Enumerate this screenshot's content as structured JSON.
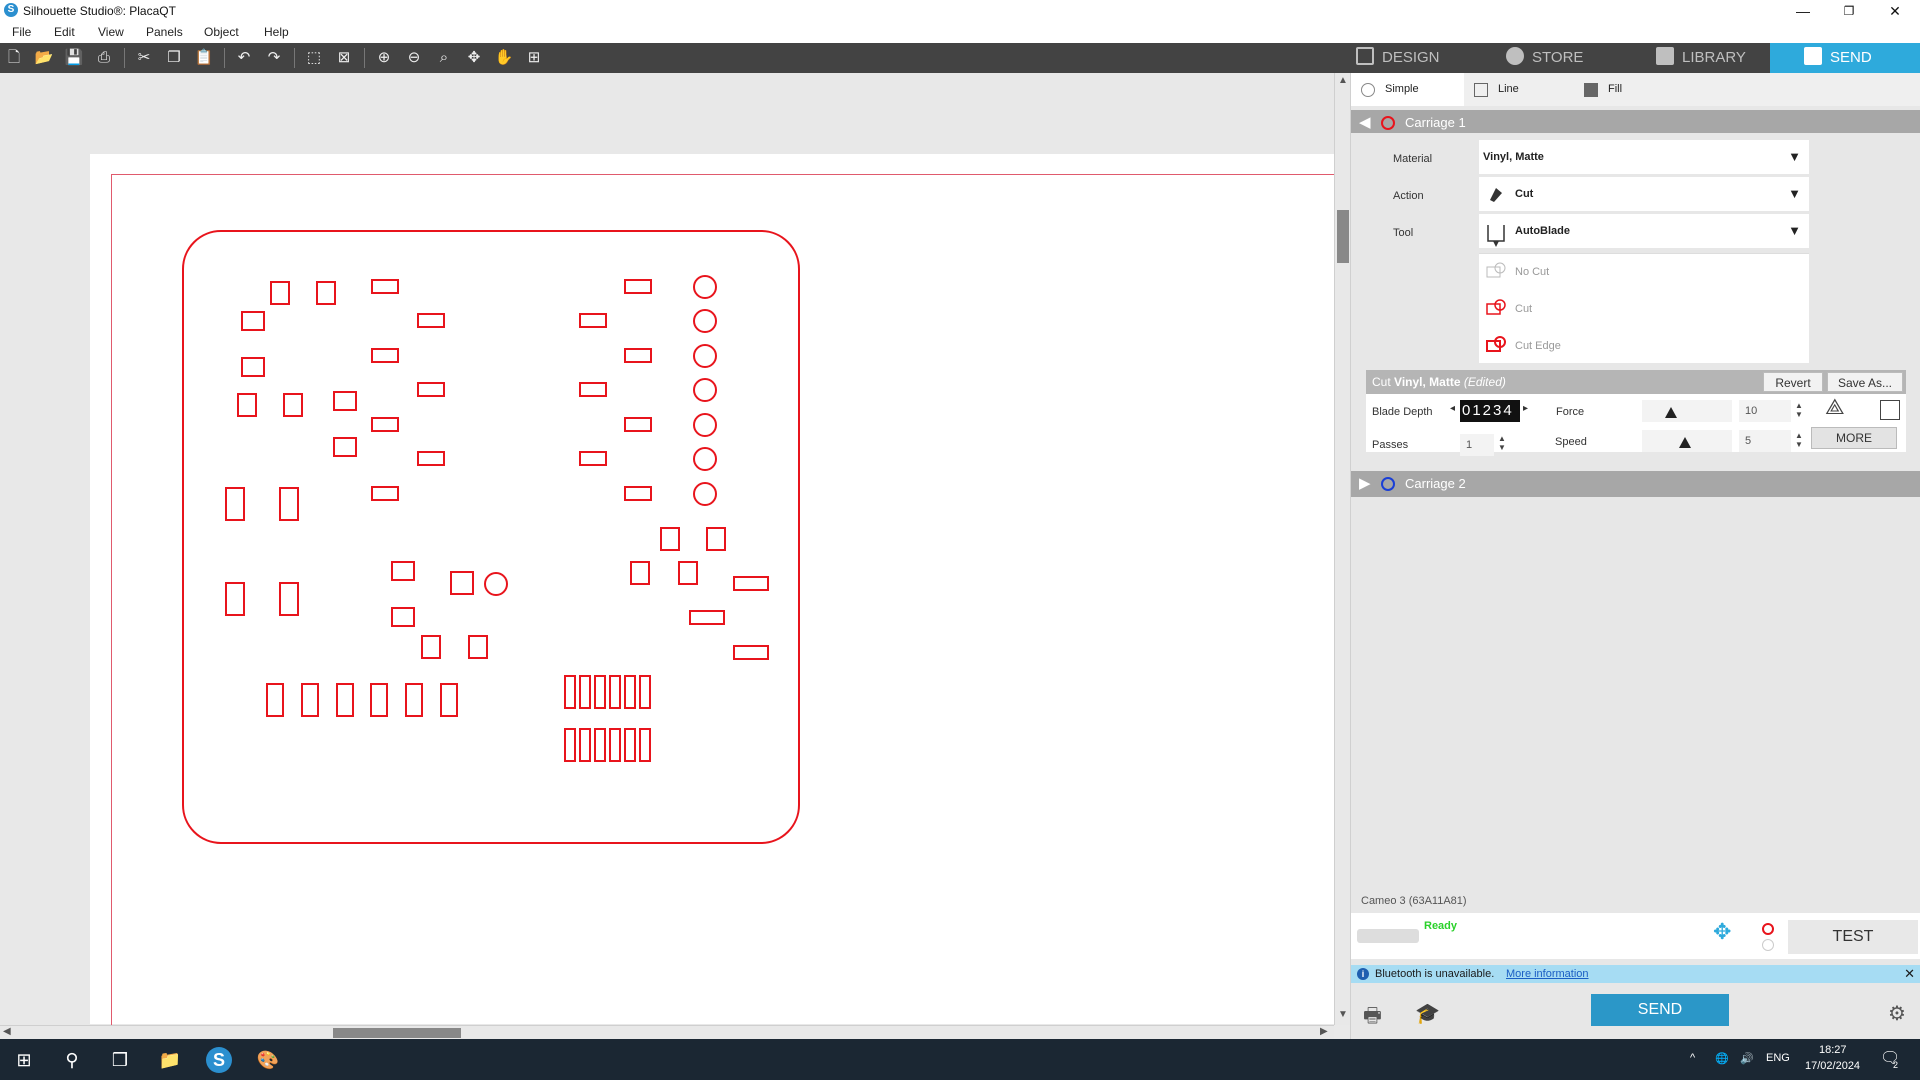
{
  "window": {
    "title": "Silhouette Studio®: PlacaQT",
    "minimize": "—",
    "restore": "❐",
    "close": "✕"
  },
  "menu": [
    "File",
    "Edit",
    "View",
    "Panels",
    "Object",
    "Help"
  ],
  "tabs": [
    {
      "label": "DESIGN",
      "icon": "grid-icon",
      "active": false
    },
    {
      "label": "STORE",
      "icon": "silhouette-s-icon",
      "active": false
    },
    {
      "label": "LIBRARY",
      "icon": "download-icon",
      "active": false
    },
    {
      "label": "SEND",
      "icon": "cutter-icon",
      "active": true
    }
  ],
  "send_panel": {
    "modes": [
      "Simple",
      "Line",
      "Fill"
    ],
    "carriage1": "Carriage 1",
    "carriage2": "Carriage 2",
    "material_label": "Material",
    "material_value": "Vinyl, Matte",
    "action_label": "Action",
    "action_value": "Cut",
    "tool_label": "Tool",
    "tool_value": "AutoBlade",
    "cut_options": [
      "No Cut",
      "Cut",
      "Cut Edge"
    ],
    "preset_prefix": "Cut",
    "preset_name": "Vinyl, Matte",
    "preset_state": "(Edited)",
    "revert_label": "Revert",
    "save_as_label": "Save As...",
    "blade_depth_label": "Blade Depth",
    "blade_depth_value": "01234",
    "force_label": "Force",
    "force_value": "10",
    "passes_label": "Passes",
    "passes_value": "1",
    "speed_label": "Speed",
    "speed_value": "5",
    "more_label": "MORE",
    "device_name": "Cameo 3 (63A11A81)",
    "device_status": "Ready",
    "test_label": "TEST",
    "bluetooth_msg": "Bluetooth is unavailable.",
    "bluetooth_link": "More information",
    "send_label": "SEND"
  },
  "taskbar": {
    "lang": "ENG",
    "time": "18:27",
    "date": "17/02/2024",
    "notifications": "2"
  },
  "colors": {
    "cut_line": "#e8141c",
    "accent": "#2eaadc",
    "toolbar": "#434343",
    "taskbar": "#1b2733"
  }
}
